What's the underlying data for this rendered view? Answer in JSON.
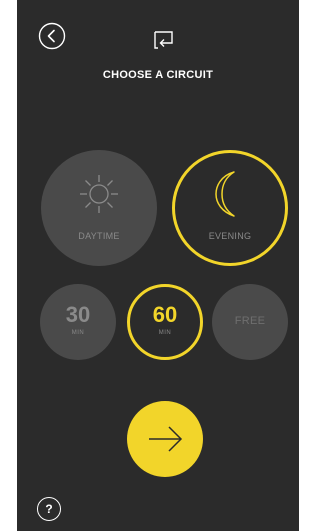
{
  "header": {
    "back_icon": "chevron-left-icon",
    "flip_icon": "return-arrow-icon",
    "title": "CHOOSE A CIRCUIT"
  },
  "time_of_day": {
    "options": [
      {
        "label": "DAYTIME",
        "icon": "sun-icon",
        "selected": false
      },
      {
        "label": "EVENING",
        "icon": "moon-icon",
        "selected": true
      }
    ]
  },
  "duration": {
    "options": [
      {
        "value": "30",
        "unit": "MIN",
        "selected": false
      },
      {
        "value": "60",
        "unit": "MIN",
        "selected": true
      },
      {
        "label": "FREE",
        "selected": false
      }
    ]
  },
  "go_button": {
    "icon": "arrow-right-icon"
  },
  "help": {
    "label": "?"
  },
  "colors": {
    "background": "#2b2b2b",
    "inactive": "#4a4a4a",
    "accent": "#f2d52a",
    "inactive_text": "#8a8a8a",
    "text": "#ffffff"
  }
}
